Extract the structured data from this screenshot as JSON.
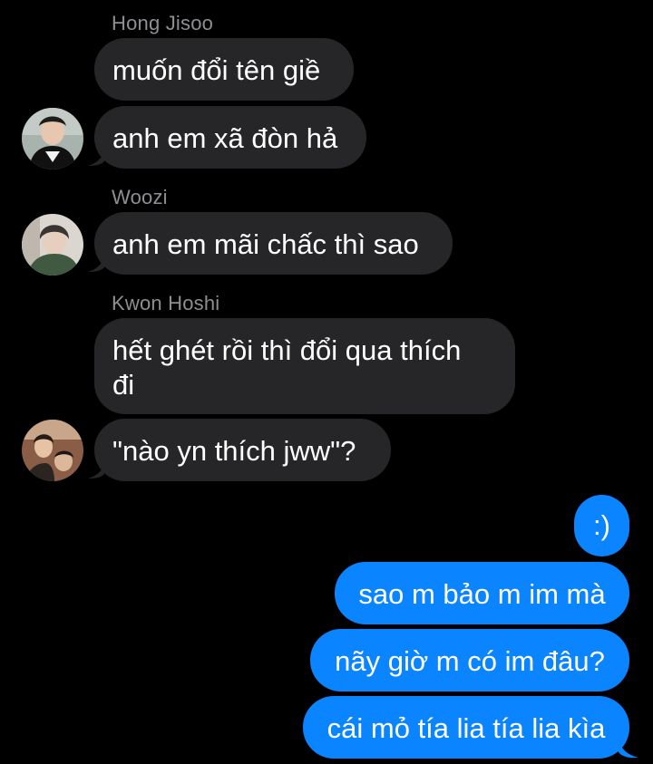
{
  "conversation": {
    "messages": [
      {
        "sender": "Hong Jisoo",
        "text": "muốn đổi tên giề"
      },
      {
        "text": "anh em xã đòn hả"
      },
      {
        "sender": "Woozi",
        "text": "anh em mãi chấc thì sao"
      },
      {
        "sender": "Kwon Hoshi",
        "text_line1": "hết ghét rồi thì đổi qua thích",
        "text_line2": "đi"
      },
      {
        "text": "\"nào yn thích jww\"?"
      }
    ],
    "outgoing": [
      {
        "text": ":)"
      },
      {
        "text": "sao m bảo m im mà"
      },
      {
        "text": "nãy giờ m có im đâu?"
      },
      {
        "text": "cái mỏ tía lia tía lia kìa"
      }
    ]
  },
  "colors": {
    "background": "#000000",
    "incoming_bubble": "#262628",
    "outgoing_bubble": "#0a84ff",
    "sender_name": "#8e8e93"
  }
}
